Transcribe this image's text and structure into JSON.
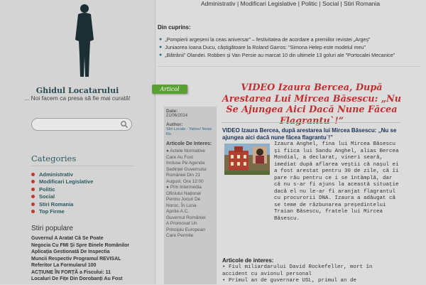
{
  "site": {
    "title": "Ghidul Locatarului",
    "tagline": "... Noi facem ca presa să fie mai curată!"
  },
  "search": {
    "placeholder": ""
  },
  "nav": {
    "text": "Administrativ | Modificari Legislative | Politic | Social | Stiri Romania"
  },
  "cuprins": {
    "title": "Din cuprins:",
    "items": [
      "„Pompierii argeșeni la ceas aniversar” – festivitatea de acordare a premiilor revistei „Argeș”",
      "Juniaorea Ioana Ducu, câștigătoare la Roland Garros: \"Simona Helep este modelul meu\"",
      "„Bătrânii” Olandei. Robben și Van Persie au marcat 10 din ultimele 13 goluri ale \"Portocalei Mecanice\""
    ]
  },
  "sidebar": {
    "categories_title": "Categories",
    "categories": [
      "Administrativ",
      "Modificari Legislative",
      "Politic",
      "Social",
      "Stiri Romania",
      "Top Firme"
    ],
    "popular_title": "Stiri populare",
    "popular": [
      "Guvernul A Aratat Că Se Poate",
      "Negocia Cu FMI Și Spre Binele Românilor",
      "Aplicația Gestionată De Inspectia",
      "Muncii Respectiv Programul REVISAL",
      "Referitor La Formularul 100",
      "ACȚIUNE ÎN FORȚĂ a Fiscului: 11",
      "Localuri De Fițe Din Dorobanți Au Fost"
    ]
  },
  "post": {
    "ribbon": "Articol",
    "title": "VIDEO Izaura Bercea, După Arestarea Lui Mircea Băsescu: „Nu Se Ajungea Aici Dacă Nune Făcea Flagrantu`!”",
    "intro": "VIDEO Izaura Bercea, după arestarea lui Mircea Băsescu: „Nu se ajungea aici dacă nune făcea flagrantu`!”",
    "body": "Izaura Anghel, fina lui Mircea Băsescu și fiica lui Sandu Anghel, alias Bercea Mondial, a declarat, vineri seară, imediat după aflarea veștii că nașul ei a fost arestat pentru 30 de zile, că îi pare rău pentru ce i se întâmplă, dar că nu s-ar fi ajuns la această situație dacă el nu le-ar fi aranjat flagrantul cu procurorii DNA. Izaura a adăugat că se teme de răzbunarea președintelui Traian Băsescu, fratele lui Mircea Băsescu.",
    "interes_title": "Articole de interes:",
    "interes": [
      "Fiul miliardarului David Rockefeller, mort în accident cu avionul personal",
      "Primul an de guvernare USL, primul an de"
    ]
  },
  "meta": {
    "date_label": "Date:",
    "date": "21/06/2014",
    "author_label": "Author:",
    "author": "Stiri Locale · Yahoo! News Ro",
    "interes_title": "Articole De Interes:",
    "related": [
      "Actele Normative",
      "Care Au Fost",
      "Incluse Pe Agenda",
      "Ședinței Guvernului",
      "României Din 21",
      "August, Ora 12:00",
      "Prin Intermedia",
      "Oficiului Național",
      "Pentru Jocuri De",
      "Noroc, În Luna",
      "Aprilie A.C.",
      "Guvernul României",
      "A Promovat Un",
      "Principiu European",
      "Care Permite"
    ]
  },
  "colors": {
    "accent_green": "#5aa032",
    "title_red": "#c03030",
    "link_teal": "#2a5a5a"
  }
}
